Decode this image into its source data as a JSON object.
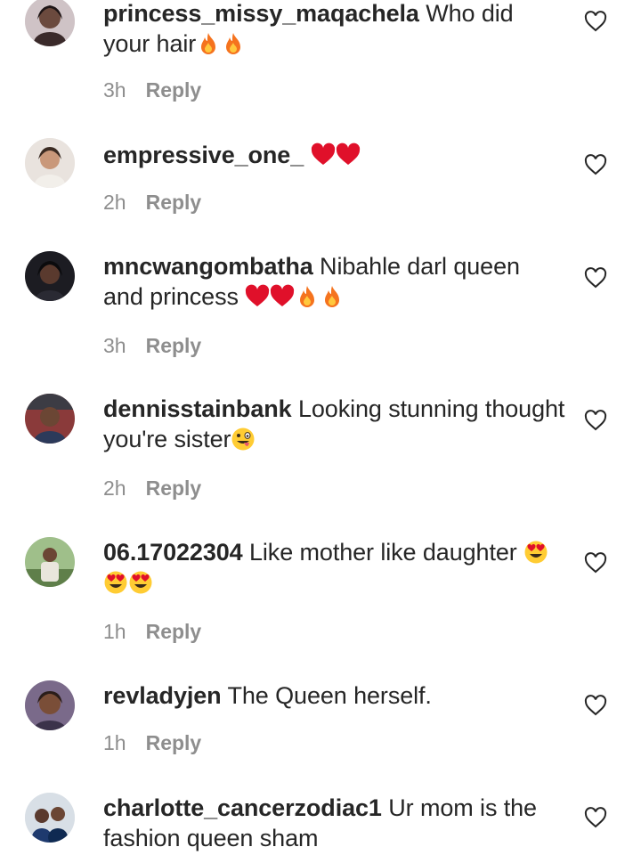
{
  "colors": {
    "text": "#262626",
    "muted": "#8e8e8e",
    "heart_red": "#e0102a",
    "fire_orange": "#f5731e"
  },
  "comments": [
    {
      "username": "princess_missy_maqachela",
      "text": "Who did your hair",
      "emojis": [
        "fire-emoji",
        "fire-emoji"
      ],
      "time": "3h",
      "reply": "Reply"
    },
    {
      "username": "empressive_one_",
      "text": "",
      "emojis": [
        "red-heart-emoji",
        "red-heart-emoji"
      ],
      "time": "2h",
      "reply": "Reply"
    },
    {
      "username": "mncwangombatha",
      "text": "Nibahle darl queen and princess",
      "emojis": [
        "red-heart-emoji",
        "red-heart-emoji",
        "fire-emoji",
        "fire-emoji"
      ],
      "time": "3h",
      "reply": "Reply"
    },
    {
      "username": "dennisstainbank",
      "text": "Looking stunning thought you're sister",
      "emojis": [
        "zany-face-emoji"
      ],
      "time": "2h",
      "reply": "Reply"
    },
    {
      "username": "06.17022304",
      "text": "Like mother like daughter",
      "emojis": [
        "heart-eyes-emoji",
        "heart-eyes-emoji",
        "heart-eyes-emoji"
      ],
      "time": "1h",
      "reply": "Reply"
    },
    {
      "username": "revladyjen",
      "text": "The Queen herself.",
      "emojis": [],
      "time": "1h",
      "reply": "Reply"
    },
    {
      "username": "charlotte_cancerzodiac1",
      "text": "Ur mom is the fashion queen sham",
      "emojis": [],
      "time": "",
      "reply": ""
    }
  ]
}
